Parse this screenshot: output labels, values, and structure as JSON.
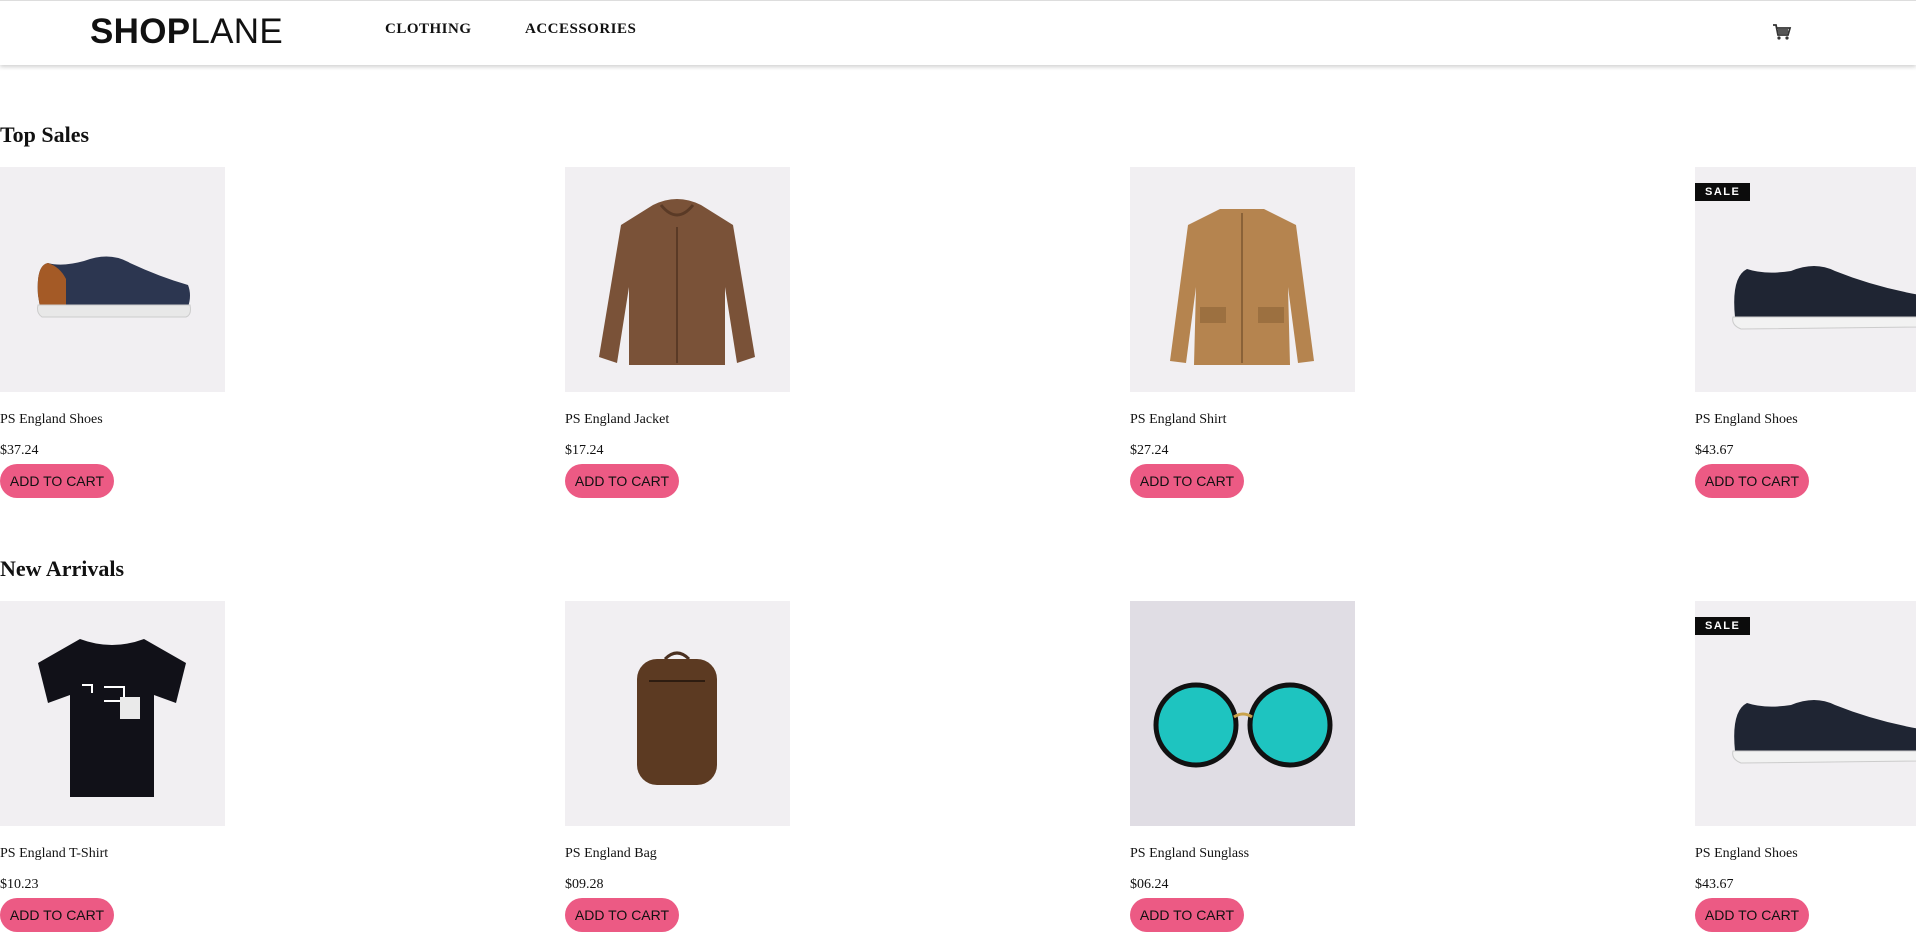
{
  "header": {
    "logo_bold": "SHOP",
    "logo_light": "LANE",
    "nav": [
      "CLOTHING",
      "ACCESSORIES"
    ],
    "cart_icon": "shopping-cart-icon"
  },
  "sections": [
    {
      "title": "Top Sales",
      "products": [
        {
          "name": "PS England Shoes",
          "price": "$37.24",
          "button": "ADD TO CART",
          "badge": ""
        },
        {
          "name": "PS England Jacket",
          "price": "$17.24",
          "button": "ADD TO CART",
          "badge": ""
        },
        {
          "name": "PS England Shirt",
          "price": "$27.24",
          "button": "ADD TO CART",
          "badge": ""
        },
        {
          "name": "PS England Shoes",
          "price": "$43.67",
          "button": "ADD TO CART",
          "badge": "SALE"
        }
      ]
    },
    {
      "title": "New Arrivals",
      "products": [
        {
          "name": "PS England T-Shirt",
          "price": "$10.23",
          "button": "ADD TO CART",
          "badge": ""
        },
        {
          "name": "PS England Bag",
          "price": "$09.28",
          "button": "ADD TO CART",
          "badge": ""
        },
        {
          "name": "PS England Sunglass",
          "price": "$06.24",
          "button": "ADD TO CART",
          "badge": ""
        },
        {
          "name": "PS England Shoes",
          "price": "$43.67",
          "button": "ADD TO CART",
          "badge": "SALE"
        }
      ]
    }
  ],
  "colors": {
    "button": "#ec5a84",
    "image_bg": "#f1eff2",
    "badge_bg": "#0c0c0c"
  }
}
